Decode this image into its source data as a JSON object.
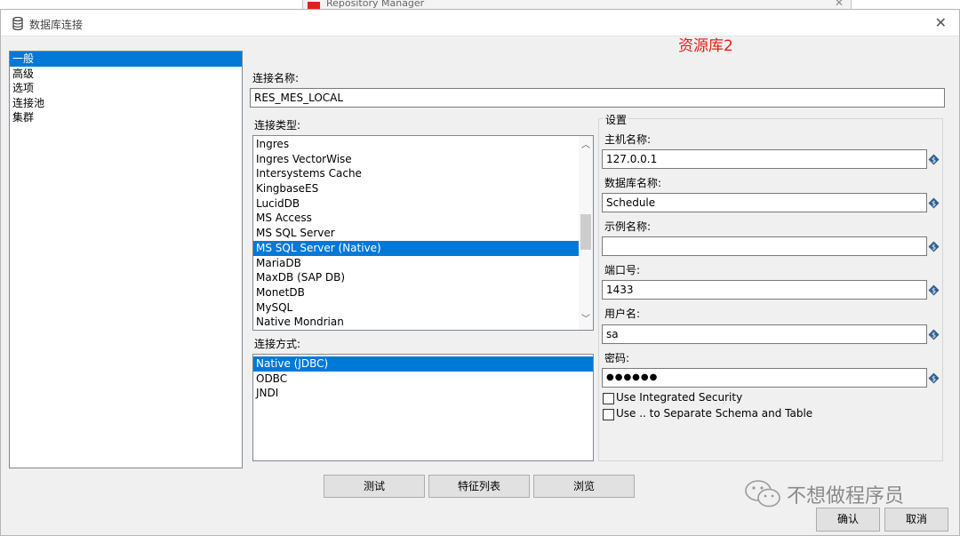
{
  "background_window": {
    "title": "Repository Manager"
  },
  "dialog": {
    "title": "数据库连接",
    "annotation": "资源库2",
    "nav": [
      {
        "label": "一般",
        "selected": true
      },
      {
        "label": "高级",
        "selected": false
      },
      {
        "label": "选项",
        "selected": false
      },
      {
        "label": "连接池",
        "selected": false
      },
      {
        "label": "集群",
        "selected": false
      }
    ],
    "connection_name": {
      "label": "连接名称:",
      "value": "RES_MES_LOCAL"
    },
    "connection_type": {
      "label": "连接类型:",
      "items": [
        "Ingres",
        "Ingres VectorWise",
        "Intersystems Cache",
        "KingbaseES",
        "LucidDB",
        "MS Access",
        "MS SQL Server",
        "MS SQL Server (Native)",
        "MariaDB",
        "MaxDB (SAP DB)",
        "MonetDB",
        "MySQL",
        "Native Mondrian"
      ],
      "selected": "MS SQL Server (Native)"
    },
    "access_method": {
      "label": "连接方式:",
      "items": [
        "Native (JDBC)",
        "ODBC",
        "JNDI"
      ],
      "selected": "Native (JDBC)"
    },
    "settings": {
      "title": "设置",
      "host": {
        "label": "主机名称:",
        "value": "127.0.0.1"
      },
      "database": {
        "label": "数据库名称:",
        "value": "Schedule"
      },
      "instance": {
        "label": "示例名称:",
        "value": ""
      },
      "port": {
        "label": "端口号:",
        "value": "1433"
      },
      "user": {
        "label": "用户名:",
        "value": "sa"
      },
      "password": {
        "label": "密码:",
        "value": "●●●●●●"
      },
      "integrated_security": {
        "label": "Use Integrated Security",
        "checked": false
      },
      "separate_schema": {
        "label": "Use .. to Separate Schema and Table",
        "checked": false
      }
    },
    "buttons": {
      "test": "测试",
      "features": "特征列表",
      "browse": "浏览",
      "ok": "确认",
      "cancel": "取消"
    },
    "watermark": "不想做程序员"
  }
}
